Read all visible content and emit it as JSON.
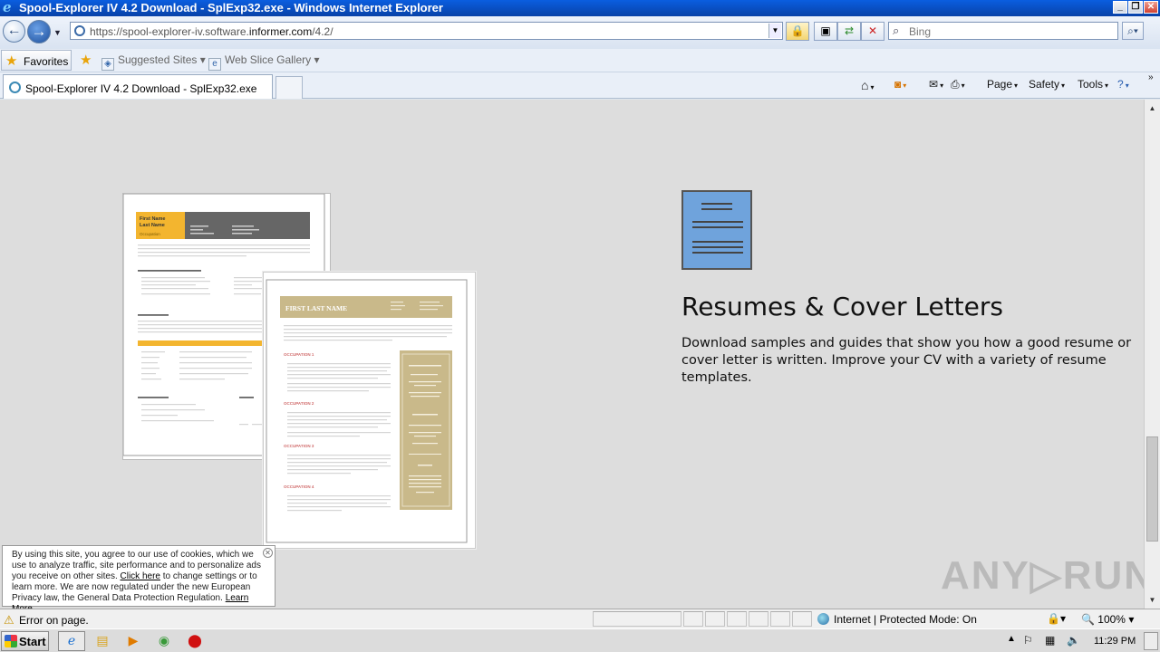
{
  "window": {
    "title": "Spool-Explorer IV 4.2 Download - SplExp32.exe - Windows Internet Explorer",
    "minimize": "_",
    "maximize": "❐",
    "close": "✕"
  },
  "address_bar": {
    "url_prefix": "https://spool-explorer-iv.software.",
    "url_domain": "informer.com",
    "url_suffix": "/4.2/"
  },
  "search": {
    "placeholder": "Bing"
  },
  "favorites_bar": {
    "favorites_label": "Favorites",
    "items": [
      {
        "label": "Suggested Sites"
      },
      {
        "label": "Web Slice Gallery"
      }
    ]
  },
  "tabs": [
    {
      "label": "Spool-Explorer IV 4.2 Download - SplExp32.exe"
    }
  ],
  "command_bar": {
    "page": "Page",
    "safety": "Safety",
    "tools": "Tools"
  },
  "content": {
    "section_title": "Resumes & Cover Letters",
    "section_description": "Download samples and guides that show you how a good resume or cover letter is written. Improve your CV with a variety of resume templates.",
    "resume1": {
      "name_line1": "First Name",
      "name_line2": "Last Name",
      "occupation": "Occupation"
    },
    "resume2": {
      "name": "FIRST LAST NAME",
      "occupation_labels": [
        "OCCUPATION 1",
        "OCCUPATION 2",
        "OCCUPATION 3",
        "OCCUPATION 4"
      ]
    }
  },
  "cookie_notice": {
    "text_1": "By using this site, you agree to our use of cookies, which we use to analyze traffic, site performance and to personalize ads you receive on other sites.",
    "link_1": "Click here",
    "text_2": "to change settings or to learn more. We are now regulated under the new European Privacy law, the General Data Protection Regulation.",
    "link_2": "Learn More",
    "text_3": "."
  },
  "watermark": "ANY▷RUN",
  "status_bar": {
    "message": "Error on page.",
    "zone": "Internet | Protected Mode: On",
    "zoom": "100%"
  },
  "taskbar": {
    "start_label": "Start",
    "clock": "11:29 PM"
  },
  "colors": {
    "titlebar": "#0842a8",
    "resume1_accent": "#f3b52f",
    "resume1_header_gray": "#666666",
    "resume2_accent": "#c9b98a",
    "resume2_occupation": "#d06a6a",
    "doc_icon_fill": "#6fa3dc"
  }
}
